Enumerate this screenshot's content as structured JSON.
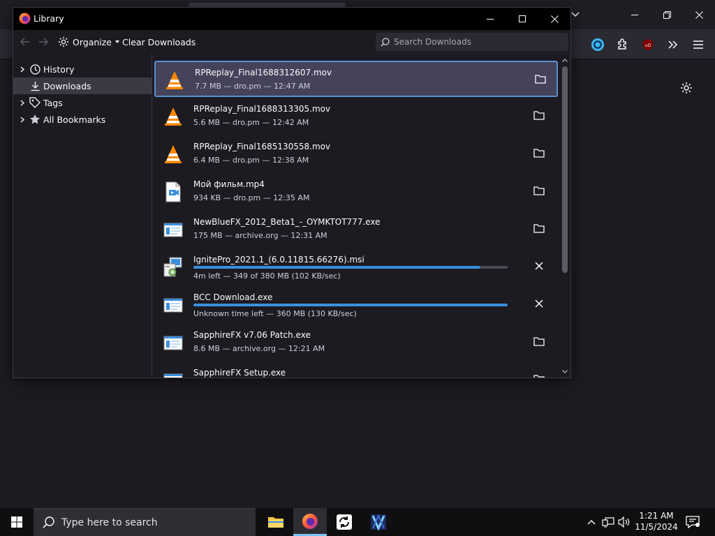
{
  "window": {
    "title": "Library"
  },
  "toolbar": {
    "organize_label": "Organize",
    "clear_downloads_label": "Clear Downloads",
    "search_placeholder": "Search Downloads"
  },
  "sidebar": {
    "items": [
      {
        "label": "History",
        "icon": "clock-icon",
        "expandable": true,
        "selected": false
      },
      {
        "label": "Downloads",
        "icon": "download-icon",
        "expandable": false,
        "selected": true
      },
      {
        "label": "Tags",
        "icon": "tag-icon",
        "expandable": true,
        "selected": false
      },
      {
        "label": "All Bookmarks",
        "icon": "star-icon",
        "expandable": true,
        "selected": false
      }
    ]
  },
  "downloads": [
    {
      "name": "RPReplay_Final1688312607.mov",
      "status": "7.7 MB — dro.pm — 12:47 AM",
      "icon": "vlc-icon",
      "state": "done",
      "selected": true
    },
    {
      "name": "RPReplay_Final1688313305.mov",
      "status": "5.6 MB — dro.pm — 12:42 AM",
      "icon": "vlc-icon",
      "state": "done",
      "selected": false
    },
    {
      "name": "RPReplay_Final1685130558.mov",
      "status": "6.4 MB — dro.pm — 12:38 AM",
      "icon": "vlc-icon",
      "state": "done",
      "selected": false
    },
    {
      "name": "Мой фильм.mp4",
      "status": "934 KB — dro.pm — 12:35 AM",
      "icon": "video-file-icon",
      "state": "done",
      "selected": false
    },
    {
      "name": "NewBlueFX_2012_Beta1_-_OYMKTOT777.exe",
      "status": "175 MB — archive.org — 12:31 AM",
      "icon": "exe-file-icon",
      "state": "done",
      "selected": false
    },
    {
      "name": "IgnitePro_2021.1_(6.0.11815.66276).msi",
      "status": "4m left — 349 of 380 MB (102 KB/sec)",
      "icon": "msi-installer-icon",
      "state": "downloading",
      "progress": 0.91,
      "selected": false
    },
    {
      "name": "BCC Download.exe",
      "status": "Unknown time left — 360 MB (130 KB/sec)",
      "icon": "exe-file-icon",
      "state": "downloading",
      "progress": 1.0,
      "selected": false
    },
    {
      "name": "SapphireFX v7.06 Patch.exe",
      "status": "8.6 MB — archive.org — 12:21 AM",
      "icon": "exe-file-icon",
      "state": "done",
      "selected": false
    },
    {
      "name": "SapphireFX Setup.exe",
      "status": "",
      "icon": "exe-file-icon",
      "state": "done",
      "selected": false
    }
  ],
  "taskbar": {
    "search_placeholder": "Type here to search",
    "time": "1:21 AM",
    "date": "11/5/2024"
  },
  "colors": {
    "accent": "#3a8fdc",
    "selection_border": "#5b8fd1",
    "background": "#1c1b22"
  }
}
